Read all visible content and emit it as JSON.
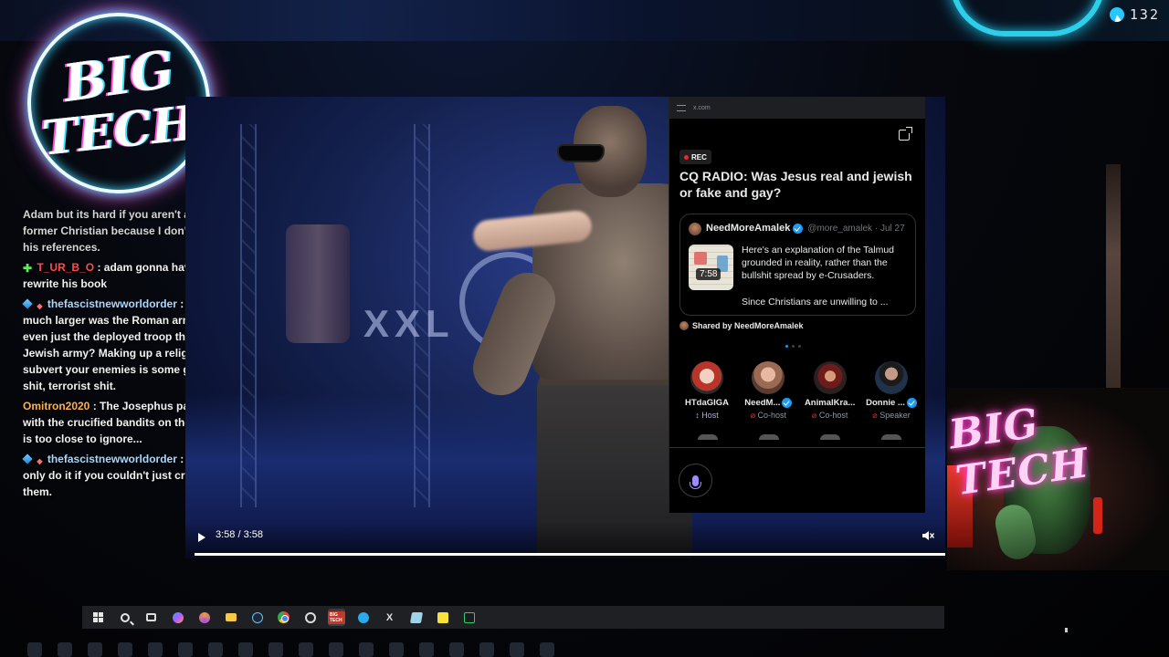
{
  "overlay": {
    "viewer_count": "132",
    "logo_line1": "BIG",
    "logo_line2": "TECH",
    "webcam_text": "BIG TECH"
  },
  "chat": {
    "messages": [
      {
        "user": "",
        "text": "Adam but its hard if you aren't a former Christian because I don't know his references.",
        "partial_top": true
      },
      {
        "user": "T_UR_B_O",
        "text": ": adam gonna have to rewrite his book"
      },
      {
        "user": "thefascistnewworldorder",
        "text": ": How much larger was the Roman army, even just the deployed troop than the Jewish army? Making up a religion to subvert your enemies is some guerilla shit, terrorist shit."
      },
      {
        "user": "Omitron2020",
        "text": ": The Josephus passage with the crucified bandits on the road is too close to ignore..."
      },
      {
        "user": "thefascistnewworldorder",
        "text": ": You'd only do it if you couldn't just crush them."
      }
    ]
  },
  "video": {
    "time": "3:58 / 3:58",
    "progress_fraction": 1.0,
    "stage_symbol": "XXL"
  },
  "space_panel": {
    "url": "x.com",
    "rec_label": "REC",
    "title": "CQ RADIO: Was Jesus real and jewish or fake and gay?",
    "post": {
      "author": "NeedMoreAmalek",
      "handle": "@more_amalek · Jul 27",
      "duration": "7:58",
      "excerpt": "Here's an explanation of the Talmud grounded in reality, rather than the bullshit spread by e-Crusaders.",
      "excerpt2": "Since Christians are unwilling to ..."
    },
    "shared_by": "Shared by NeedMoreAmalek",
    "participants": [
      {
        "name": "HTdaGIGA",
        "role": "Host",
        "verified": false
      },
      {
        "name": "NeedM...",
        "role": "Co-host",
        "verified": true
      },
      {
        "name": "AnimalKra...",
        "role": "Co-host",
        "verified": false
      },
      {
        "name": "Donnie ...",
        "role": "Speaker",
        "verified": true
      }
    ]
  },
  "taskbar": {
    "items": [
      "start",
      "search",
      "task-view",
      "copilot",
      "chrome-profile",
      "file-explorer",
      "steam",
      "chrome",
      "obs",
      "stream-app",
      "telegram",
      "x",
      "notepad",
      "sticky-notes",
      "terminal"
    ],
    "x_label": "X",
    "stream_app_label": "BIG TECH"
  }
}
